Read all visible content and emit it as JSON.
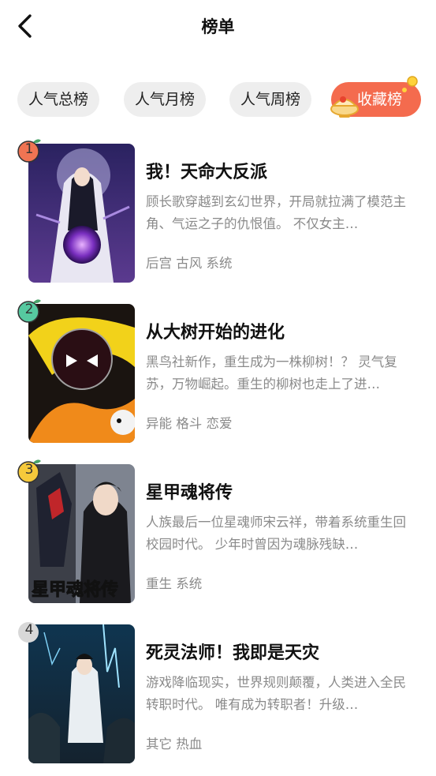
{
  "header": {
    "title": "榜单"
  },
  "tabs": [
    "人气总榜",
    "人气月榜",
    "人气周榜"
  ],
  "active_tab": "收藏榜",
  "colors": {
    "accent": "#f46b4e",
    "tab_bg": "#eeeeee",
    "muted_text": "#8a8a8a"
  },
  "books": [
    {
      "rank": "1",
      "title": "我！天命大反派",
      "desc": "顾长歌穿越到玄幻世界，开局就拉满了模范主角、气运之子的仇恨值。 不仅女主…",
      "tags": "后宫 古风 系统",
      "badge_color": "#f07453"
    },
    {
      "rank": "2",
      "title": "从大树开始的进化",
      "desc": "黑鸟社新作，重生成为一株柳树！？ 灵气复苏，万物崛起。重生的柳树也走上了进…",
      "tags": "异能 格斗 恋爱",
      "badge_color": "#56c9a0"
    },
    {
      "rank": "3",
      "title": "星甲魂将传",
      "desc": "人族最后一位星魂师宋云祥，带着系统重生回校园时代。 少年时曾因为魂脉残缺…",
      "tags": "重生 系统",
      "badge_color": "#f6c93b"
    },
    {
      "rank": "4",
      "title": "死灵法师！我即是天灾",
      "desc": "游戏降临现实，世界规则颠覆，人类进入全民转职时代。 唯有成为转职者！升级…",
      "tags": "其它 热血",
      "badge_color": "#d8d8d8"
    }
  ]
}
